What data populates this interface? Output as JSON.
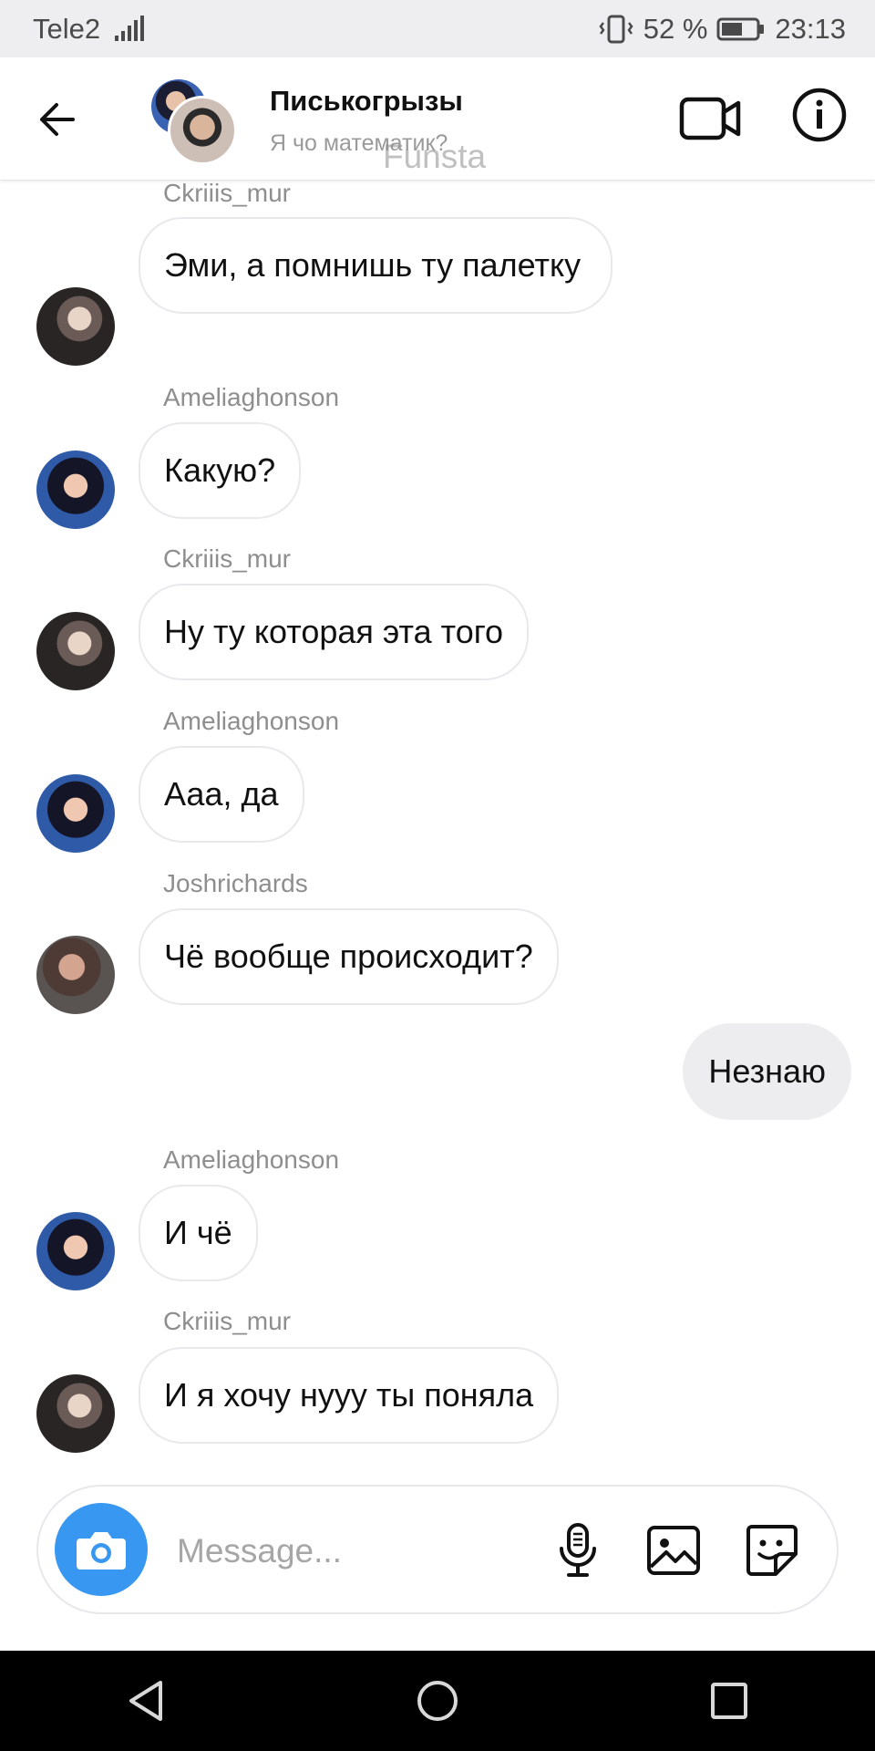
{
  "status_bar": {
    "carrier": "Tele2",
    "battery": "52 %",
    "time": "23:13"
  },
  "header": {
    "title": "Писькогрызы",
    "subtitle": "Я чо математик?",
    "watermark": "Funsta"
  },
  "messages": [
    {
      "sender": "Ckriiis_mur",
      "text": "Эми, а помнишь ту палетку"
    },
    {
      "sender": "Ameliaghonson",
      "text": "Какую?"
    },
    {
      "sender": "Ckriiis_mur",
      "text": "Ну ту которая эта того"
    },
    {
      "sender": "Ameliaghonson",
      "text": "Ааа, да"
    },
    {
      "sender": "Joshrichards",
      "text": "Чё вообще происходит?"
    },
    {
      "sender": "",
      "text": "Незнаю",
      "mine": true
    },
    {
      "sender": "Ameliaghonson",
      "text": "И чё"
    },
    {
      "sender": "Ckriiis_mur",
      "text": "И я хочу нууу ты поняла"
    }
  ],
  "composer": {
    "placeholder": "Message..."
  },
  "colors": {
    "accent": "#3897f0",
    "my_bubble": "#ededf0"
  }
}
